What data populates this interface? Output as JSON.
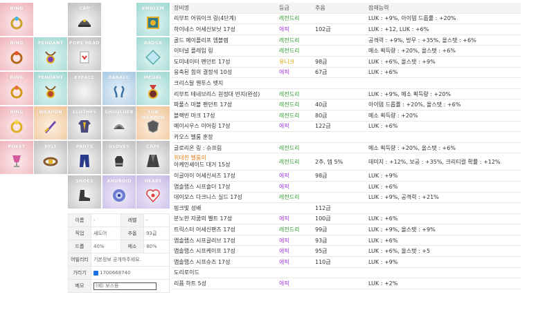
{
  "slots": [
    {
      "id": "ring1",
      "label": "RING",
      "color": "pink",
      "icon": "ring-icon"
    },
    {
      "id": "cap",
      "label": "CAP",
      "color": "gray",
      "icon": "cap-icon"
    },
    {
      "id": "emblem",
      "label": "EMBLEM",
      "color": "teal",
      "icon": "emblem-icon"
    },
    {
      "id": "ring2",
      "label": "RING",
      "color": "pink",
      "icon": "ring-icon"
    },
    {
      "id": "pendant1",
      "label": "PENDANT",
      "color": "teal",
      "icon": "pendant-icon"
    },
    {
      "id": "forehead",
      "label": "FORE HEAD",
      "color": "gray",
      "icon": "forehead-icon"
    },
    {
      "id": "badge",
      "label": "BADGE",
      "color": "teal",
      "icon": "badge-icon"
    },
    {
      "id": "ring3",
      "label": "RING",
      "color": "pink",
      "icon": "ring-icon"
    },
    {
      "id": "pendant2",
      "label": "PENDANT",
      "color": "teal",
      "icon": "pendant-icon"
    },
    {
      "id": "eyeacc",
      "label": "EYEACC",
      "color": "gray",
      "icon": "eye-accessory-icon"
    },
    {
      "id": "earacc",
      "label": "EARACC",
      "color": "blue",
      "icon": "earring-icon"
    },
    {
      "id": "medal",
      "label": "MEDAL",
      "color": "teal",
      "icon": "medal-icon"
    },
    {
      "id": "ring4",
      "label": "RING",
      "color": "pink",
      "icon": "ring-icon"
    },
    {
      "id": "weapon",
      "label": "WEAPON",
      "color": "orange",
      "icon": "weapon-icon"
    },
    {
      "id": "clothes",
      "label": "CLOTHES",
      "color": "gray",
      "icon": "clothes-icon"
    },
    {
      "id": "shoulder",
      "label": "SHOULDER",
      "color": "gray",
      "icon": "shoulder-icon"
    },
    {
      "id": "subweapon",
      "label": "SUB WEAPON",
      "color": "orange",
      "icon": "sub-weapon-icon"
    },
    {
      "id": "poket",
      "label": "POKET",
      "color": "pink",
      "icon": "pocket-icon"
    },
    {
      "id": "belt",
      "label": "BELT",
      "color": "gray",
      "icon": "belt-icon"
    },
    {
      "id": "pants",
      "label": "PANTS",
      "color": "gray",
      "icon": "pants-icon"
    },
    {
      "id": "gloves",
      "label": "GLOVES",
      "color": "gray",
      "icon": "gloves-icon"
    },
    {
      "id": "cape",
      "label": "CAPE",
      "color": "gray",
      "icon": "cape-icon"
    },
    {
      "id": "shoes",
      "label": "SHOES",
      "color": "gray",
      "icon": "shoes-icon"
    },
    {
      "id": "android",
      "label": "ANDROID",
      "color": "purple",
      "icon": "android-icon"
    },
    {
      "id": "heart",
      "label": "HEART",
      "color": "purple",
      "icon": "heart-icon"
    }
  ],
  "info": {
    "name_label": "이름",
    "name_value": "-",
    "level_label": "레벨",
    "level_value": "-",
    "job_label": "직업",
    "job_value": "섀도어",
    "chuo_label": "추옵",
    "chuo_value": "93급",
    "drop_label": "드롭",
    "drop_value": "40%",
    "meso_label": "메소",
    "meso_value": "80%",
    "ability_label": "어빌리티",
    "ability_value": "기본정보 공개하주세요.",
    "hide_label": "가리기",
    "hide_value": "1700668740",
    "memo_label": "메모",
    "memo_placeholder": "(예) 보스용"
  },
  "list": {
    "headers": [
      "장비명",
      "등급",
      "추옵",
      "잠재능력"
    ],
    "rows": [
      {
        "name": "리부트 어워이크 링(4단계)",
        "grade": "레전드리",
        "grade_type": "leg",
        "chuo": "",
        "potential": "LUK : +9%, 아이템 드롭률 : +20%"
      },
      {
        "name": "하이네스 어세신보닛 17성",
        "grade": "에픽",
        "grade_type": "epic",
        "chuo": "102급",
        "potential": "LUK : +12, LUK : +6%"
      },
      {
        "name": "골드 메이플리프 엠블렘",
        "grade": "레전드리",
        "grade_type": "leg",
        "chuo": "",
        "potential": "공격력 : +9%, 방무 : +35%, 올스탯 : +6%"
      },
      {
        "name": "이터널 플레임 링",
        "grade": "레전드리",
        "grade_type": "leg",
        "chuo": "",
        "potential": "메소 획득량 : +20%, 올스탯 : +6%"
      },
      {
        "name": "도미네이터 펜던트 17성",
        "grade": "유니크",
        "grade_type": "uni",
        "chuo": "98급",
        "potential": "LUK : +6%, 올스탯 : +9%"
      },
      {
        "name": "응축된 힘의 결정석 10성",
        "grade": "에픽",
        "grade_type": "epic",
        "chuo": "67급",
        "potential": "LUK : +6%"
      },
      {
        "name": "크리스탈 웬투스 뱃지",
        "grade": "",
        "grade_type": "",
        "chuo": "",
        "potential": ""
      },
      {
        "name": "리부트 테네브리스 원정대 반지(완성)",
        "grade": "레전드리",
        "grade_type": "leg",
        "chuo": "",
        "potential": "LUK : +9%, 메소 획득량 : +20%"
      },
      {
        "name": "파풀스 마블 펜던트 17성",
        "grade": "레전드리",
        "grade_type": "leg",
        "chuo": "40급",
        "potential": "아이템 드롭률 : +20%, 올스탯 : +6%"
      },
      {
        "name": "블랙빈 마크 17성",
        "grade": "레전드리",
        "grade_type": "leg",
        "chuo": "80급",
        "potential": "메소 획득량 : +20%"
      },
      {
        "name": "메이시우스 이어링 17성",
        "grade": "에픽",
        "grade_type": "epic",
        "chuo": "122급",
        "potential": "LUK : +6%"
      },
      {
        "name": "카오스 벨룸 훈장",
        "grade": "",
        "grade_type": "",
        "chuo": "",
        "potential": ""
      },
      {
        "name": "글로리온 링 : 슈프림",
        "grade": "레전드리",
        "grade_type": "leg",
        "chuo": "",
        "potential": "메소 획득량 : +20%, 올스탯 : +6%"
      },
      {
        "name": "위대한 벨룸의",
        "name2": "아케인셰이드 대거 15성",
        "grade": "레전드리",
        "grade_type": "leg",
        "chuo": "2추, 뎀 5%",
        "potential": "데미지 : +12%, 보공 : +35%, 크리티컬 확률 : +12%"
      },
      {
        "name": "이글아이 어세신셔츠 17성",
        "grade": "에픽",
        "grade_type": "epic",
        "chuo": "98급",
        "potential": "LUK : +9%"
      },
      {
        "name": "앱솔랩스 시프숄더 17성",
        "grade": "에픽",
        "grade_type": "epic",
        "chuo": "",
        "potential": "LUK : +6%"
      },
      {
        "name": "데이모스 다크니스 실드 17성",
        "grade": "레전드리",
        "grade_type": "leg",
        "chuo": "",
        "potential": "LUK : +9%, 공격력 : +21%"
      },
      {
        "name": "핑크빛 성배",
        "grade": "",
        "grade_type": "",
        "chuo": "112급",
        "potential": ""
      },
      {
        "name": "분노한 자쿰의 벨트 17성",
        "grade": "에픽",
        "grade_type": "epic",
        "chuo": "100급",
        "potential": "LUK : +6%"
      },
      {
        "name": "트릭스터 어세신팬츠 17성",
        "grade": "레전드리",
        "grade_type": "leg",
        "chuo": "99급",
        "potential": "LUK : +9%, 올스탯 : +9%"
      },
      {
        "name": "앱솔랩스 시프글러브 17성",
        "grade": "에픽",
        "grade_type": "epic",
        "chuo": "93급",
        "potential": "LUK : +6%"
      },
      {
        "name": "앱솔랩스 시프케이프 17성",
        "grade": "에픽",
        "grade_type": "epic",
        "chuo": "95급",
        "potential": "LUK : +6%, 올스탯 : +5"
      },
      {
        "name": "앱솔랩스 시프슈즈 17성",
        "grade": "에픽",
        "grade_type": "epic",
        "chuo": "110급",
        "potential": "LUK : +9%"
      },
      {
        "name": "도리로이드",
        "grade": "",
        "grade_type": "",
        "chuo": "",
        "potential": ""
      },
      {
        "name": "리퓸 하트 5성",
        "grade": "에픽",
        "grade_type": "epic",
        "chuo": "",
        "potential": "LUK : +2%"
      }
    ]
  }
}
